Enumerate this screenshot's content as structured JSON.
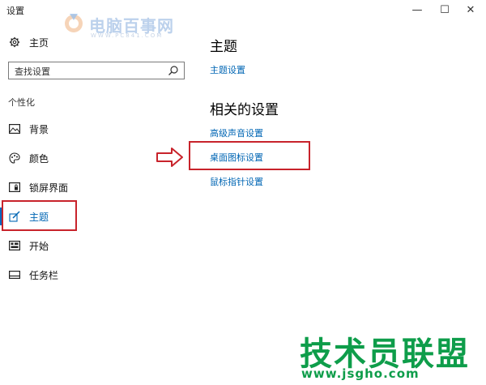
{
  "window": {
    "title": "设置",
    "minimize_glyph": "—",
    "maximize_glyph": "☐",
    "close_glyph": "✕"
  },
  "watermark_top": {
    "name": "电脑百事网",
    "url": "WWW.PC841.COM"
  },
  "sidebar": {
    "home_label": "主页",
    "home_icon": "gear-icon",
    "search_placeholder": "查找设置",
    "search_icon": "search-icon",
    "section_header": "个性化",
    "items": [
      {
        "label": "背景",
        "icon": "image-icon"
      },
      {
        "label": "颜色",
        "icon": "palette-icon"
      },
      {
        "label": "锁屏界面",
        "icon": "lock-screen-icon"
      },
      {
        "label": "主题",
        "icon": "theme-brush-icon",
        "selected": true
      },
      {
        "label": "开始",
        "icon": "start-menu-icon"
      },
      {
        "label": "任务栏",
        "icon": "taskbar-icon"
      }
    ]
  },
  "main": {
    "title": "主题",
    "theme_settings_link": "主题设置",
    "related_header": "相关的设置",
    "related_links": [
      "高级声音设置",
      "桌面图标设置",
      "鼠标指针设置"
    ]
  },
  "annotation": {
    "highlight_color": "#c8232b",
    "arrow": "hollow-right-arrow"
  },
  "watermark_bottom": {
    "name": "技术员联盟",
    "url": "www.jsgho.com"
  },
  "colors": {
    "accent": "#0067c0",
    "link": "#0066b4",
    "watermark_green": "#0e9d4a"
  }
}
